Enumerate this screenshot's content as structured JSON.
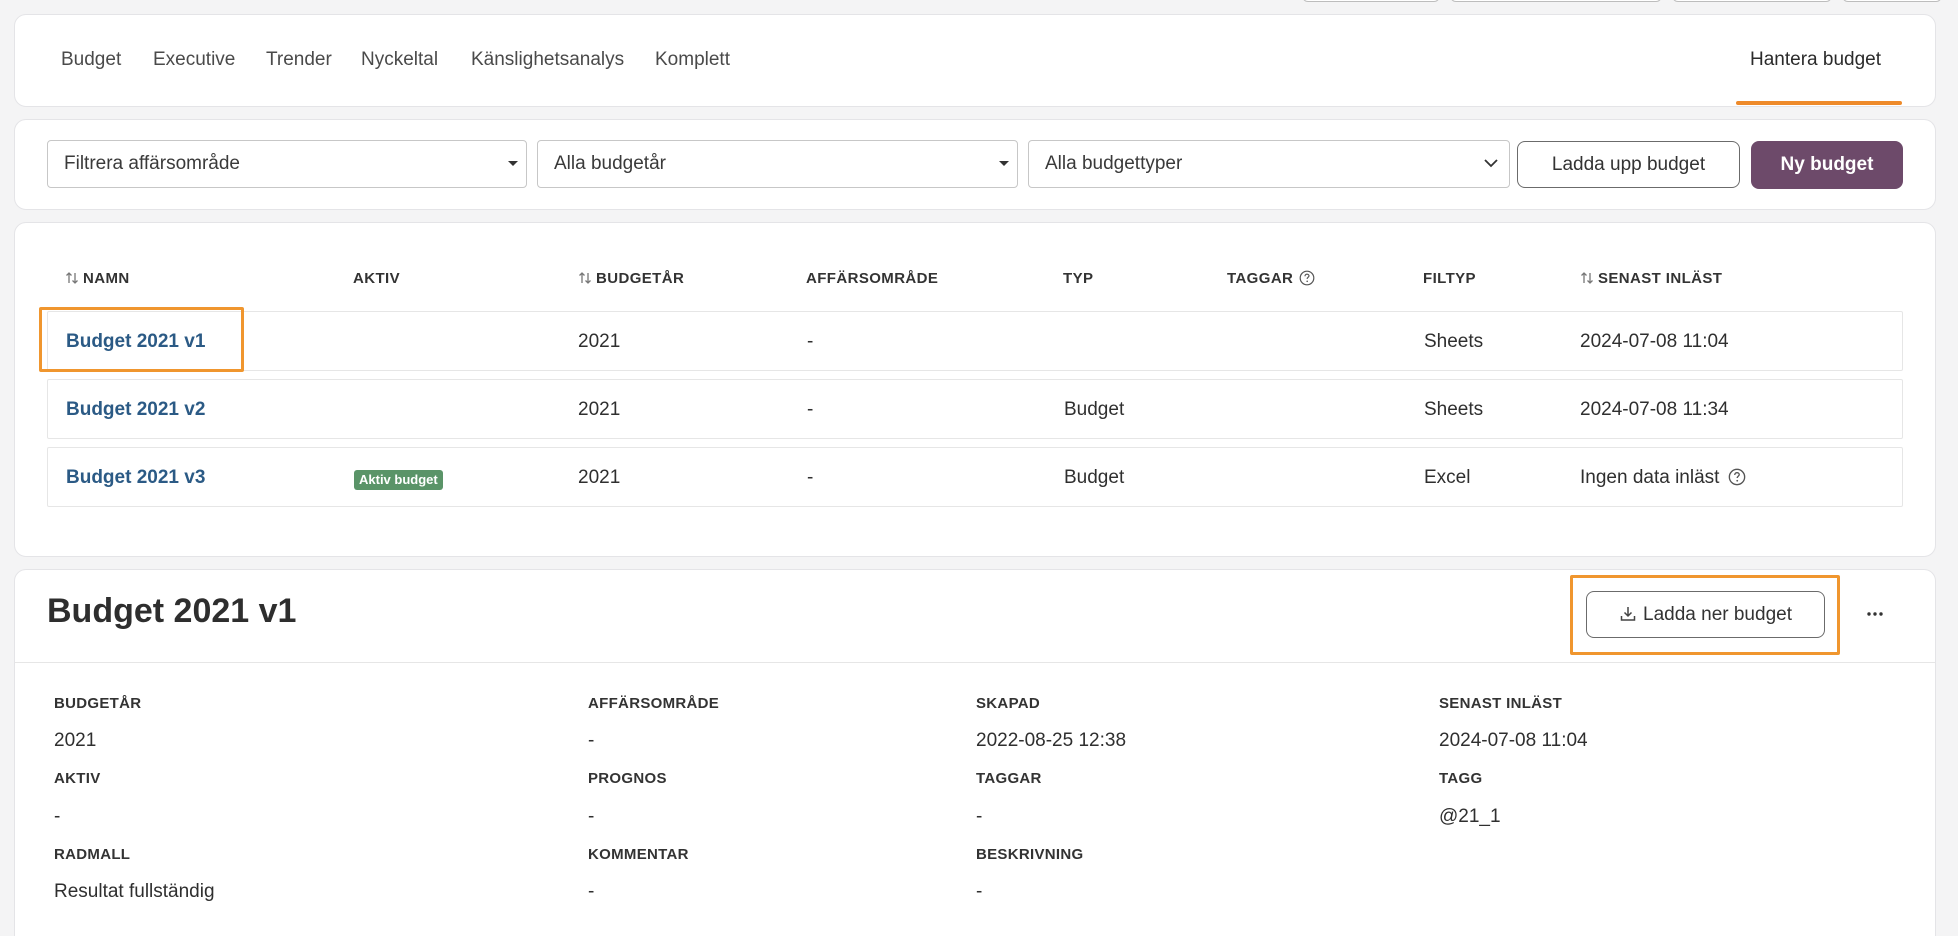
{
  "tabs": {
    "items": [
      {
        "label": "Budget"
      },
      {
        "label": "Executive"
      },
      {
        "label": "Trender"
      },
      {
        "label": "Nyckeltal"
      },
      {
        "label": "Känslighetsanalys"
      },
      {
        "label": "Komplett"
      }
    ],
    "active_label": "Hantera budget"
  },
  "filters": {
    "business_area": "Filtrera affärsområde",
    "budget_year": "Alla budgetår",
    "budget_type": "Alla budgettyper",
    "upload_label": "Ladda upp budget",
    "new_label": "Ny budget"
  },
  "table": {
    "headers": {
      "name": "NAMN",
      "active": "AKTIV",
      "year": "BUDGETÅR",
      "area": "AFFÄRSOMRÅDE",
      "type": "TYP",
      "tags": "TAGGAR",
      "filetype": "FILTYP",
      "last_loaded": "SENAST INLÄST"
    },
    "rows": [
      {
        "name": "Budget 2021 v1",
        "active": "",
        "year": "2021",
        "area": "-",
        "type": "",
        "tags": "",
        "filetype": "Sheets",
        "last_loaded": "2024-07-08 11:04"
      },
      {
        "name": "Budget 2021 v2",
        "active": "",
        "year": "2021",
        "area": "-",
        "type": "Budget",
        "tags": "",
        "filetype": "Sheets",
        "last_loaded": "2024-07-08 11:34"
      },
      {
        "name": "Budget 2021 v3",
        "active": "Aktiv budget",
        "year": "2021",
        "area": "-",
        "type": "Budget",
        "tags": "",
        "filetype": "Excel",
        "last_loaded": "Ingen data inläst"
      }
    ]
  },
  "detail": {
    "title": "Budget 2021 v1",
    "download_label": "Ladda ner budget",
    "fields": {
      "budget_year": {
        "label": "BUDGETÅR",
        "value": "2021"
      },
      "business_area": {
        "label": "AFFÄRSOMRÅDE",
        "value": "-"
      },
      "created": {
        "label": "SKAPAD",
        "value": "2022-08-25 12:38"
      },
      "last_loaded": {
        "label": "SENAST INLÄST",
        "value": "2024-07-08 11:04"
      },
      "active": {
        "label": "AKTIV",
        "value": "-"
      },
      "forecast": {
        "label": "PROGNOS",
        "value": "-"
      },
      "tags": {
        "label": "TAGGAR",
        "value": "-"
      },
      "tag": {
        "label": "TAGG",
        "value": "@21_1"
      },
      "row_template": {
        "label": "RADMALL",
        "value": "Resultat fullständig"
      },
      "comment": {
        "label": "KOMMENTAR",
        "value": "-"
      },
      "description": {
        "label": "BESKRIVNING",
        "value": "-"
      }
    }
  },
  "colors": {
    "accent": "#ee8a2a",
    "primary": "#6d4a6a",
    "link": "#2b5a85",
    "badge": "#5a9468"
  }
}
